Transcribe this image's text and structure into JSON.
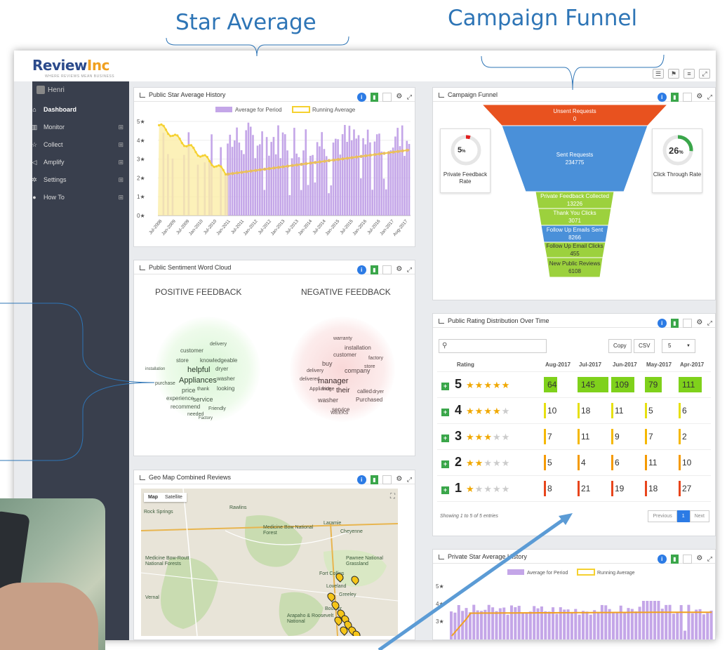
{
  "callouts": {
    "star_average": "Star Average",
    "campaign_funnel": "Campaign Funnel"
  },
  "app": {
    "logo_text": "ReviewInc",
    "logo_main": "Review",
    "logo_accent": "Inc",
    "tagline": "WHERE REVIEWS MEAN BUSINESS",
    "user_name": "Henri"
  },
  "sidebar": {
    "items": [
      {
        "label": "Dashboard",
        "icon": "home-icon",
        "active": true,
        "expandable": false
      },
      {
        "label": "Monitor",
        "icon": "monitor-icon",
        "active": false,
        "expandable": true
      },
      {
        "label": "Collect",
        "icon": "star-icon",
        "active": false,
        "expandable": true
      },
      {
        "label": "Amplify",
        "icon": "share-icon",
        "active": false,
        "expandable": true
      },
      {
        "label": "Settings",
        "icon": "gear-icon",
        "active": false,
        "expandable": true
      },
      {
        "label": "How To",
        "icon": "info-icon",
        "active": false,
        "expandable": true
      }
    ]
  },
  "colors": {
    "purple_bar": "#c4a6e8",
    "running_avg": "#f5d130",
    "funnel_red": "#e8521f",
    "funnel_blue": "#4a90d9",
    "funnel_green": "#9cd13d",
    "sidebar": "#393f4d"
  },
  "star_history": {
    "title": "Public Star Average History",
    "legend": [
      "Average for Period",
      "Running Average"
    ],
    "y_ticks": [
      "5★",
      "4★",
      "3★",
      "2★",
      "1★",
      "0★"
    ],
    "x_ticks": [
      "Jul-2008",
      "Jan-2009",
      "Jul-2009",
      "Jan-2010",
      "Jul-2010",
      "Jan-2011",
      "Jul-2011",
      "Jan-2012",
      "Jul-2012",
      "Jan-2013",
      "Jul-2013",
      "Jan-2014",
      "Jul-2014",
      "Jan-2015",
      "Jul-2015",
      "Jan-2016",
      "Jul-2016",
      "Jan-2017",
      "Aug-2017"
    ]
  },
  "sentiment": {
    "title": "Public Sentiment Word Cloud",
    "positive_label": "POSITIVE FEEDBACK",
    "negative_label": "NEGATIVE FEEDBACK",
    "positive_words": [
      "delivery",
      "customer",
      "store",
      "knowledgeable",
      "helpful",
      "dryer",
      "Appliances",
      "washer",
      "purchase",
      "price",
      "thank",
      "looking",
      "experience",
      "service",
      "recommend",
      "Friendly",
      "needed",
      "Factory",
      "installation"
    ],
    "negative_words": [
      "warranty",
      "installation",
      "customer",
      "factory",
      "buy",
      "delivery",
      "company",
      "store",
      "delivered",
      "manager",
      "Appliance",
      "fridge",
      "their",
      "called",
      "dryer",
      "washer",
      "Purchased",
      "service",
      "WEEKS"
    ]
  },
  "geo_map": {
    "title": "Geo Map Combined Reviews",
    "map_btn": "Map",
    "satellite_btn": "Satellite",
    "places": [
      "Rock Springs",
      "Rawlins",
      "Laramie",
      "Cheyenne",
      "Medicine Bow National Forest",
      "Pawnee National Grassland",
      "Medicine Bow-Routt National Forests",
      "Vernal",
      "Fort Collins",
      "Loveland",
      "Greeley",
      "Arapaho & Roosevelt National",
      "Boulder"
    ]
  },
  "funnel": {
    "title": "Campaign Funnel",
    "left_gauge": {
      "value": "5",
      "unit": "%",
      "label": "Private Feedback Rate",
      "fraction": 0.05
    },
    "right_gauge": {
      "value": "26",
      "unit": "%",
      "label": "Click Through Rate",
      "fraction": 0.26
    },
    "stages": [
      {
        "label": "Unsent Requests",
        "value": "0"
      },
      {
        "label": "Sent Requests",
        "value": "234775"
      },
      {
        "label": "Private Feedback Collected",
        "value": "13226"
      },
      {
        "label": "Thank You Clicks",
        "value": "3071"
      },
      {
        "label": "Follow Up Emails Sent",
        "value": "8266"
      },
      {
        "label": "Follow Up Email Clicks",
        "value": "455"
      },
      {
        "label": "New Public Reviews",
        "value": "6108"
      }
    ]
  },
  "rating_dist": {
    "title": "Public Rating Distribution Over Time",
    "copy_btn": "Copy",
    "csv_btn": "CSV",
    "page_size": "5",
    "rating_header": "Rating",
    "months": [
      "Aug-2017",
      "Jul-2017",
      "Jun-2017",
      "May-2017",
      "Apr-2017"
    ],
    "rows": [
      {
        "rating": "5",
        "stars": 5,
        "values": [
          64,
          145,
          109,
          79,
          111
        ]
      },
      {
        "rating": "4",
        "stars": 4,
        "values": [
          10,
          18,
          11,
          5,
          6
        ]
      },
      {
        "rating": "3",
        "stars": 3,
        "values": [
          7,
          11,
          9,
          7,
          2
        ]
      },
      {
        "rating": "2",
        "stars": 2,
        "values": [
          5,
          4,
          6,
          11,
          10
        ]
      },
      {
        "rating": "1",
        "stars": 1,
        "values": [
          8,
          21,
          19,
          18,
          27
        ]
      }
    ],
    "showing_text": "Showing 1 to 5 of 5 entries",
    "prev_btn": "Previous",
    "page_num": "1",
    "next_btn": "Next"
  },
  "private_history": {
    "title": "Private Star Average History",
    "legend": [
      "Average for Period",
      "Running Average"
    ],
    "y_ticks": [
      "5★",
      "4★",
      "3★"
    ]
  }
}
